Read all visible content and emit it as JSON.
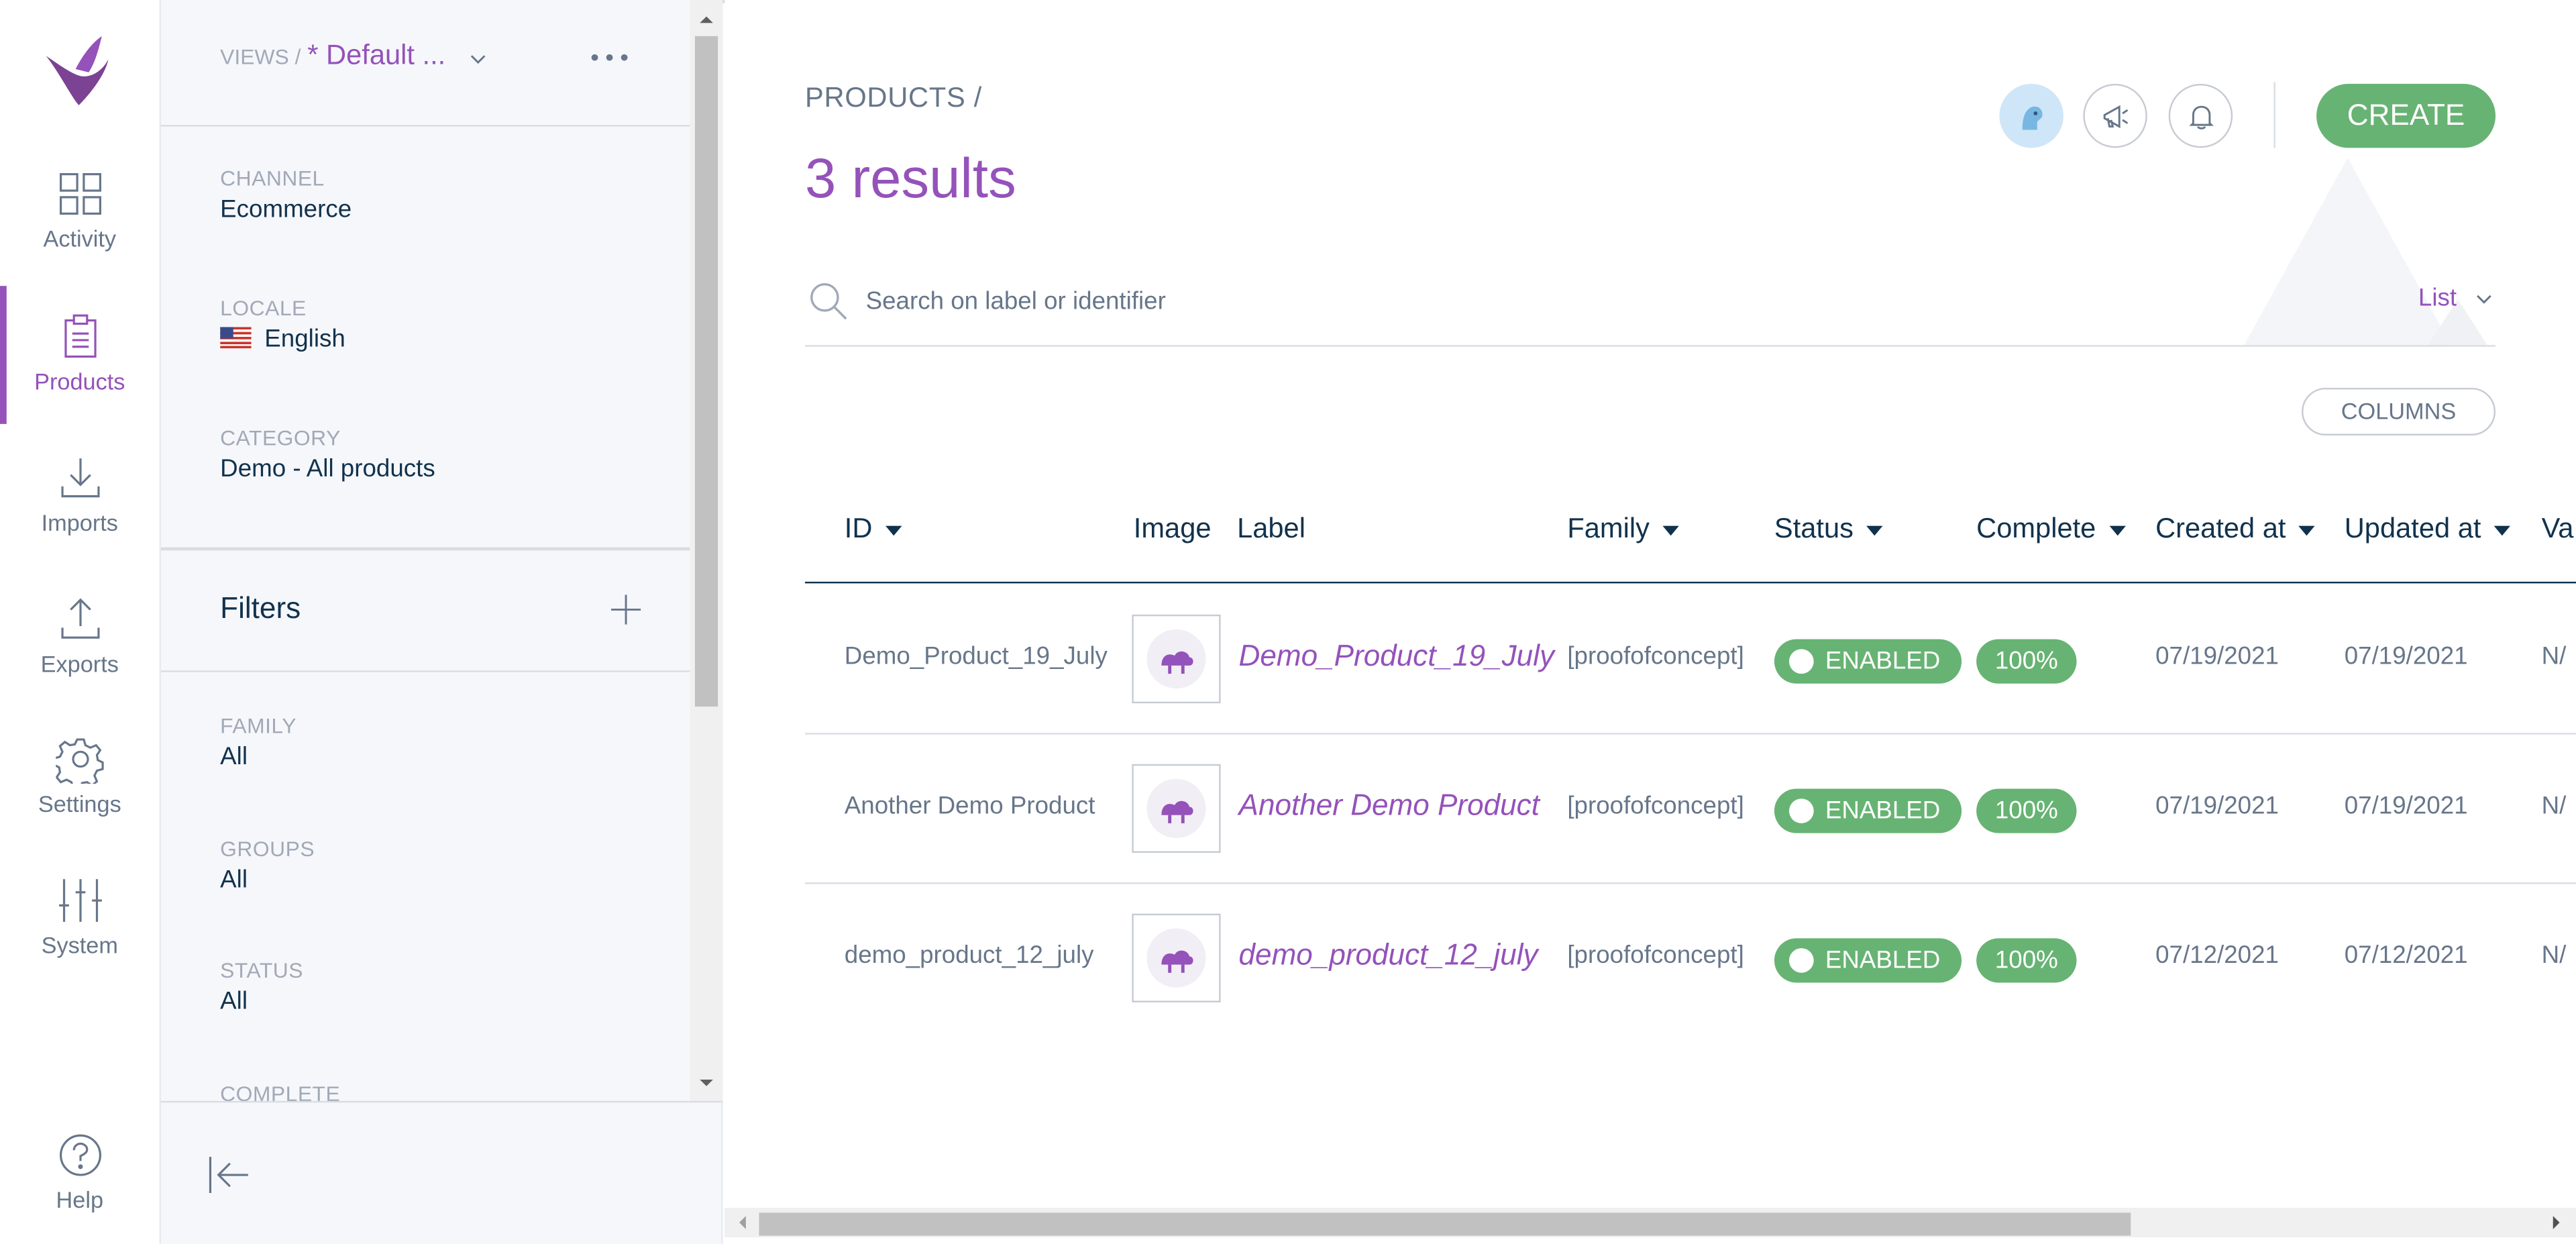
{
  "nav": {
    "items": [
      {
        "label": "Activity",
        "icon": "dashboard-icon"
      },
      {
        "label": "Products",
        "icon": "clipboard-icon",
        "active": true
      },
      {
        "label": "Imports",
        "icon": "import-icon"
      },
      {
        "label": "Exports",
        "icon": "export-icon"
      },
      {
        "label": "Settings",
        "icon": "gear-icon"
      },
      {
        "label": "System",
        "icon": "sliders-icon"
      }
    ],
    "help": {
      "label": "Help",
      "icon": "help-icon"
    }
  },
  "panel": {
    "views_prefix": "VIEWS /",
    "view_name": "* Default ...",
    "channel": {
      "key": "CHANNEL",
      "value": "Ecommerce"
    },
    "locale": {
      "key": "LOCALE",
      "value": "English"
    },
    "category": {
      "key": "CATEGORY",
      "value": "Demo - All products"
    },
    "filters_title": "Filters",
    "filters": [
      {
        "key": "FAMILY",
        "value": "All"
      },
      {
        "key": "GROUPS",
        "value": "All"
      },
      {
        "key": "STATUS",
        "value": "All"
      },
      {
        "key": "COMPLETE",
        "value": ""
      }
    ]
  },
  "main": {
    "breadcrumb": "PRODUCTS /",
    "results": "3 results",
    "create_label": "CREATE",
    "search_placeholder": "Search on label or identifier",
    "display_mode": "List",
    "columns_label": "COLUMNS",
    "headers": {
      "id": "ID",
      "image": "Image",
      "label": "Label",
      "family": "Family",
      "status": "Status",
      "complete": "Complete",
      "created": "Created at",
      "updated": "Updated at",
      "variant": "Va"
    },
    "rows": [
      {
        "id": "Demo_Product_19_July",
        "label": "Demo_Product_19_July",
        "family": "[proofofconcept]",
        "status": "ENABLED",
        "complete": "100%",
        "created": "07/19/2021",
        "updated": "07/19/2021",
        "variant": "N/"
      },
      {
        "id": "Another Demo Product",
        "label": "Another Demo Product",
        "family": "[proofofconcept]",
        "status": "ENABLED",
        "complete": "100%",
        "created": "07/19/2021",
        "updated": "07/19/2021",
        "variant": "N/"
      },
      {
        "id": "demo_product_12_july",
        "label": "demo_product_12_july",
        "family": "[proofofconcept]",
        "status": "ENABLED",
        "complete": "100%",
        "created": "07/12/2021",
        "updated": "07/12/2021",
        "variant": "N/"
      }
    ]
  },
  "colors": {
    "accent": "#9452ba",
    "success": "#67b373",
    "text": "#67768a",
    "dark": "#11324d"
  }
}
